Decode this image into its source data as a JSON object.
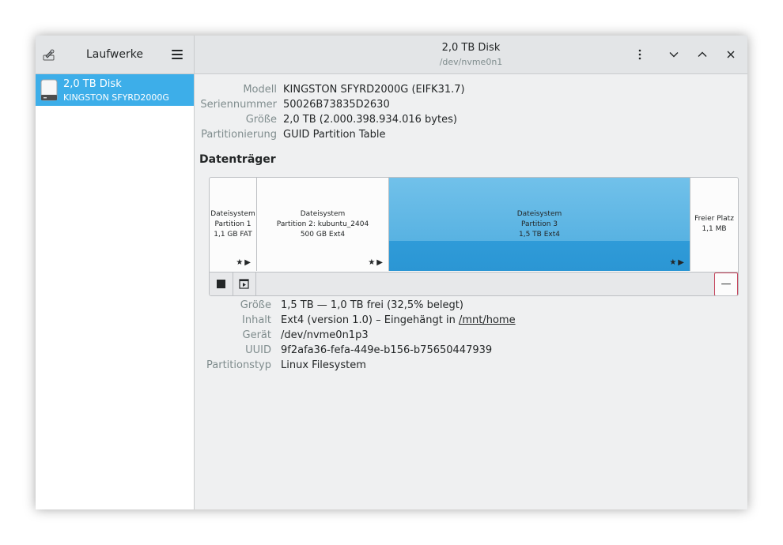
{
  "sidebar": {
    "title": "Laufwerke",
    "drives": [
      {
        "name": "2,0 TB Disk",
        "model": "KINGSTON SFYRD2000G"
      }
    ]
  },
  "header": {
    "title": "2,0 TB Disk",
    "subtitle": "/dev/nvme0n1"
  },
  "drive_info": [
    {
      "label": "Modell",
      "value": "KINGSTON SFYRD2000G (EIFK31.7)"
    },
    {
      "label": "Seriennummer",
      "value": "50026B73835D2630"
    },
    {
      "label": "Größe",
      "value": "2,0 TB (2.000.398.934.016 bytes)"
    },
    {
      "label": "Partitionierung",
      "value": "GUID Partition Table"
    }
  ],
  "volumes": {
    "title": "Datenträger",
    "segments": [
      {
        "line1": "Dateisystem",
        "line2": "Partition 1",
        "line3": "1,1 GB FAT",
        "actions": "★▶"
      },
      {
        "line1": "Dateisystem",
        "line2": "Partition 2: kubuntu_2404",
        "line3": "500 GB Ext4",
        "actions": "★▶"
      },
      {
        "line1": "Dateisystem",
        "line2": "Partition 3",
        "line3": "1,5 TB Ext4",
        "actions": "★▶"
      },
      {
        "line1": "Freier Platz",
        "line2": "1,1 MB"
      }
    ],
    "minus_label": "—"
  },
  "partition_info": {
    "size_label": "Größe",
    "size_value": "1,5 TB — 1,0 TB frei (32,5% belegt)",
    "content_label": "Inhalt",
    "content_value": "Ext4 (version 1.0) – Eingehängt in ",
    "mount_point": "/mnt/home",
    "device_label": "Gerät",
    "device_value": "/dev/nvme0n1p3",
    "uuid_label": "UUID",
    "uuid_value": "9f2afa36-fefa-449e-b156-b75650447939",
    "type_label": "Partitionstyp",
    "type_value": "Linux Filesystem"
  },
  "colors": {
    "selection": "#3daee9",
    "destructive": "#c5445b"
  }
}
